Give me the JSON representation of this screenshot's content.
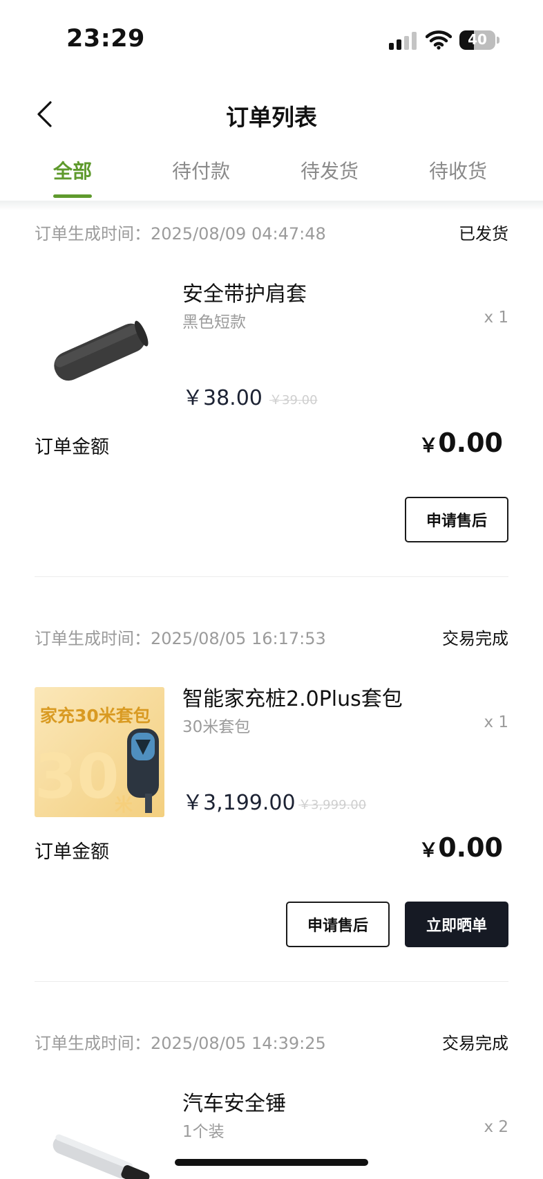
{
  "status_bar": {
    "time": "23:29",
    "battery": "40",
    "battery_level": 0.4
  },
  "header": {
    "title": "订单列表"
  },
  "tabs": [
    {
      "label": "全部",
      "active": true
    },
    {
      "label": "待付款",
      "active": false
    },
    {
      "label": "待发货",
      "active": false
    },
    {
      "label": "待收货",
      "active": false
    }
  ],
  "orders": [
    {
      "time": "订单生成时间：2025/08/09 04:47:48",
      "status": "已发货",
      "product": {
        "name": "安全带护肩套",
        "spec": "黑色短款",
        "qty": "x 1",
        "price": "￥38.00",
        "original_price": "￥39.00"
      },
      "amount_label": "订单金额",
      "amount_currency": "￥",
      "amount_value": "0.00",
      "actions": [
        "申请售后"
      ]
    },
    {
      "time": "订单生成时间：2025/08/05 16:17:53",
      "status": "交易完成",
      "product": {
        "name": "智能家充桩2.0Plus套包",
        "spec": "30米套包",
        "qty": "x 1",
        "price": "￥3,199.00",
        "original_price": "￥3,999.00",
        "image_text": "家充30米套包",
        "image_big": "30",
        "image_unit": "米"
      },
      "amount_label": "订单金额",
      "amount_currency": "￥",
      "amount_value": "0.00",
      "actions": [
        "申请售后",
        "立即晒单"
      ]
    },
    {
      "time": "订单生成时间：2025/08/05 14:39:25",
      "status": "交易完成",
      "product": {
        "name": "汽车安全锤",
        "spec": "1个装",
        "qty": "x 2"
      }
    }
  ],
  "colors": {
    "accent": "#5f9a2d",
    "dark_button": "#161a24",
    "muted_text": "#9b9b9b"
  },
  "icons": {
    "back": "chevron-left-icon",
    "signal": "signal-icon",
    "wifi": "wifi-icon",
    "battery": "battery-icon"
  }
}
